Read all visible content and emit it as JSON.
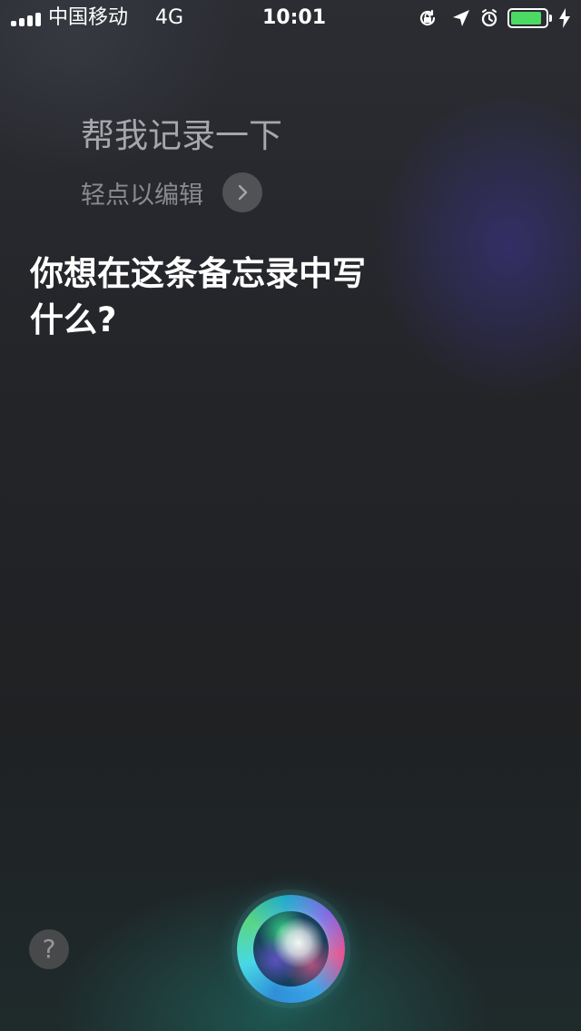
{
  "status_bar": {
    "carrier": "中国移动",
    "network": "4G",
    "time": "10:01",
    "battery_level": 0.9,
    "battery_color": "#4cd964",
    "icons": [
      "signal-bars-icon",
      "lock-rotation-icon",
      "location-arrow-icon",
      "alarm-clock-icon",
      "battery-icon",
      "charging-bolt-icon"
    ]
  },
  "siri": {
    "user_query": "帮我记录一下",
    "edit_label": "轻点以编辑",
    "edit_icon": "chevron-right-icon",
    "response_line_1": "你想在这条备忘录中写",
    "response_line_2": "什么?"
  },
  "controls": {
    "help_label": "?",
    "siri_orb_icon": "siri-orb-icon"
  }
}
